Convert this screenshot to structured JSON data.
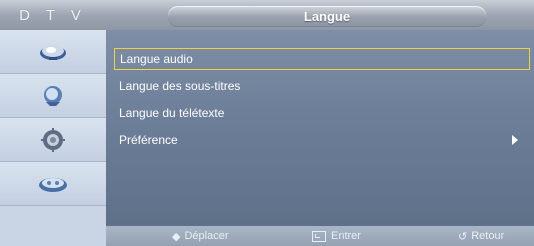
{
  "header": {
    "source_label": "D T V",
    "title": "Langue"
  },
  "sidebar": {
    "items": [
      {
        "icon": "picture-icon",
        "active": true
      },
      {
        "icon": "sound-icon",
        "active": false
      },
      {
        "icon": "setup-icon",
        "active": false
      },
      {
        "icon": "input-icon",
        "active": false
      }
    ]
  },
  "menu": {
    "items": [
      {
        "label": "Langue audio",
        "selected": true
      },
      {
        "label": "Langue des sous-titres",
        "selected": false
      },
      {
        "label": "Langue du télétexte",
        "selected": false
      },
      {
        "label": "Préférence",
        "selected": false,
        "has_submenu": true
      }
    ]
  },
  "footer": {
    "move_label": "Déplacer",
    "enter_label": "Entrer",
    "return_label": "Retour"
  },
  "colors": {
    "highlight_border": "#f0d23a",
    "panel": "#6d7f98",
    "sidebar": "#c9d5e4"
  }
}
